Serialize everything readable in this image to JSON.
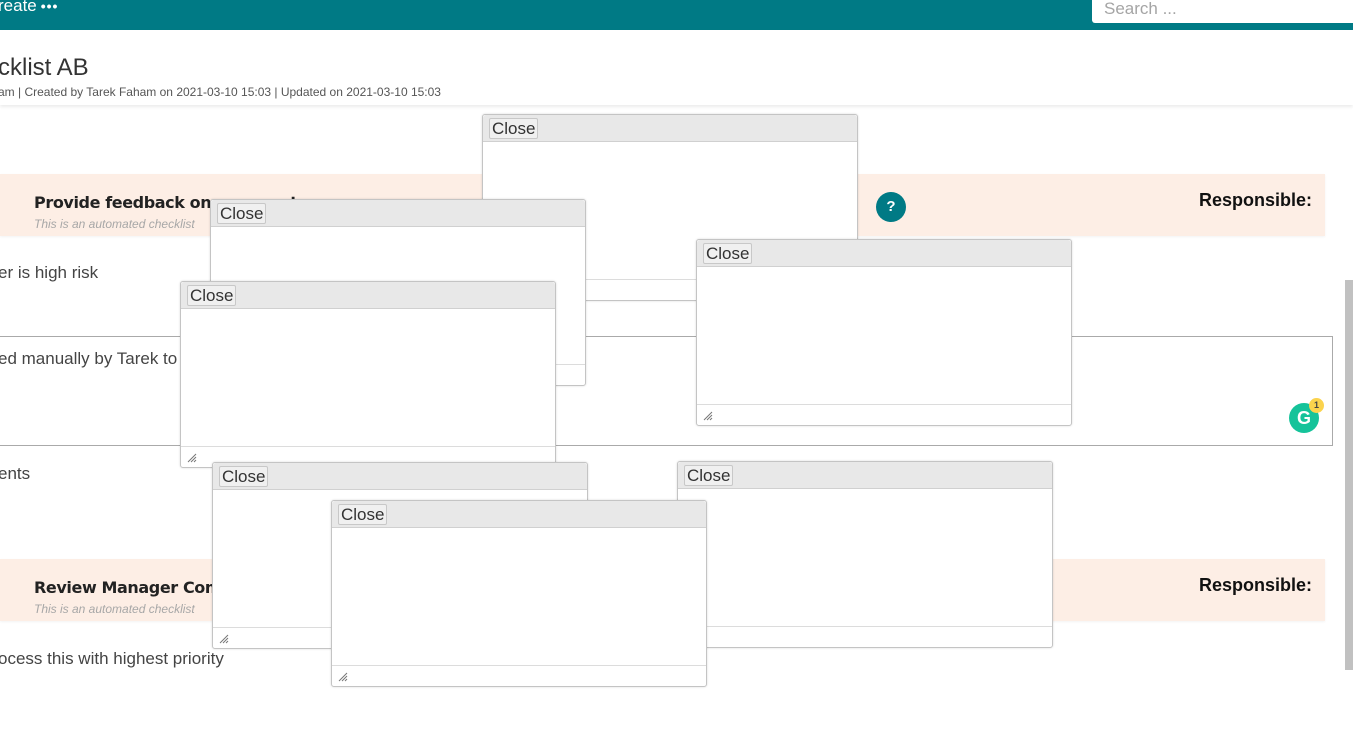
{
  "topbar": {
    "create_label": "reate",
    "create_more": "•••",
    "search_placeholder": "Search ..."
  },
  "header": {
    "title": "cklist AB",
    "meta": "am | Created by Tarek Faham on 2021-03-10 15:03 | Updated on 2021-03-10 15:03"
  },
  "sections": [
    {
      "title": "Provide feedback on comments",
      "subtitle": "This is an automated checklist",
      "responsible_label": "Responsible:"
    },
    {
      "title": "Review Manager Comments",
      "subtitle": "This is an automated checklist",
      "responsible_label": "Responsible:"
    }
  ],
  "help_icon": "?",
  "items": {
    "high_risk": "er is high risk",
    "manual": "ed manually by Tarek to",
    "comments": "ents",
    "priority": "ocess this with highest priority"
  },
  "grammarly": {
    "icon": "grammarly-icon",
    "letter": "G",
    "count": "1"
  },
  "dialogs": [
    {
      "close_label": "Close"
    },
    {
      "close_label": "Close"
    },
    {
      "close_label": "Close"
    },
    {
      "close_label": "Close"
    },
    {
      "close_label": "Close"
    },
    {
      "close_label": "Close"
    },
    {
      "close_label": "Close"
    }
  ]
}
